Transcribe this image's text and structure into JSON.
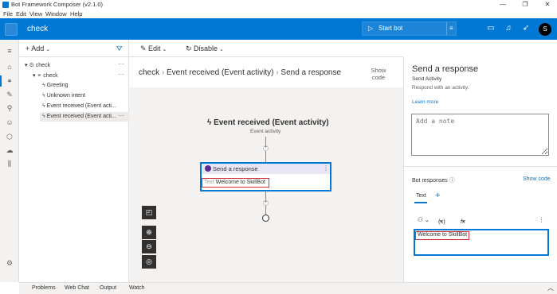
{
  "window": {
    "title": "Bot Framework Composer (v2.1.0)",
    "controls": [
      "—",
      "❐",
      "✕"
    ]
  },
  "menu": [
    "File",
    "Edit",
    "View",
    "Window",
    "Help"
  ],
  "header": {
    "project": "check",
    "start_bot": "Start bot",
    "avatar": "S"
  },
  "nav": {
    "add": "Add",
    "tree": [
      {
        "label": "check",
        "level": 0
      },
      {
        "label": "check",
        "level": 1
      },
      {
        "label": "Greeting",
        "level": 2
      },
      {
        "label": "Unknown intent",
        "level": 2
      },
      {
        "label": "Event received (Event acti...",
        "level": 2
      },
      {
        "label": "Event received (Event acti...",
        "level": 2,
        "selected": true
      }
    ]
  },
  "toolbar": {
    "edit": "Edit",
    "disable": "Disable"
  },
  "breadcrumb": {
    "items": [
      "check",
      "Event received (Event activity)",
      "Send a response"
    ],
    "show_code": "Show code"
  },
  "canvas": {
    "trigger_title": "Event received (Event activity)",
    "trigger_sub": "Event activity",
    "action_title": "Send a response",
    "action_text_label": "Text",
    "action_text_value": "Welcome to SkillBot"
  },
  "right_panel": {
    "title": "Send a response",
    "subtitle": "Send Activity",
    "description": "Respond with an activity.",
    "learn_more": "Learn more",
    "note_placeholder": "Add a note",
    "bot_responses": "Bot responses",
    "show_code": "Show code",
    "tab_text": "Text",
    "var_btn": "(x)",
    "fx_btn": "fx",
    "editor_value": "Welcome to SkillBot"
  },
  "bottom": [
    "Problems",
    "Web Chat",
    "Output",
    "Watch"
  ],
  "colors": {
    "accent": "#0078d4",
    "highlight": "#d13438"
  }
}
